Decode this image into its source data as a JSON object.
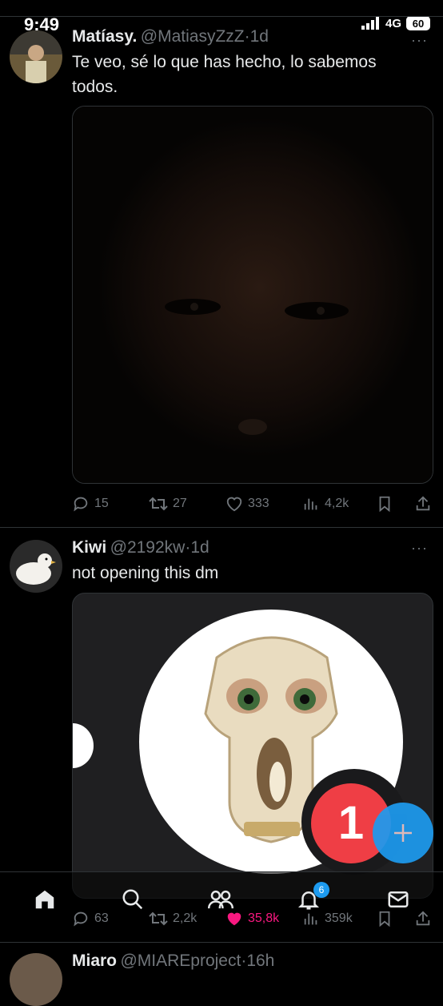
{
  "status": {
    "time": "9:49",
    "network": "4G",
    "battery": "60"
  },
  "tweet1": {
    "name": "Matíasy.",
    "handle": "@MatiasyZzZ",
    "time": "1d",
    "text": "Te veo, sé lo que has hecho, lo sabemos todos.",
    "replies": "15",
    "retweets": "27",
    "likes": "333",
    "views": "4,2k"
  },
  "tweet2": {
    "name": "Kiwi",
    "handle": "@2192kw",
    "time": "1d",
    "text": "not opening this dm",
    "replies": "63",
    "retweets": "2,2k",
    "likes": "35,8k",
    "views": "359k",
    "image_badge": "1"
  },
  "tweet3": {
    "name": "Miaro",
    "handle": "@MIAREproject",
    "time": "16h"
  },
  "separator": "·",
  "more": "···",
  "tabbar": {
    "notifications_badge": "6"
  },
  "colors": {
    "accent": "#1d9bf0",
    "like": "#f91880",
    "muted": "#71767b"
  }
}
